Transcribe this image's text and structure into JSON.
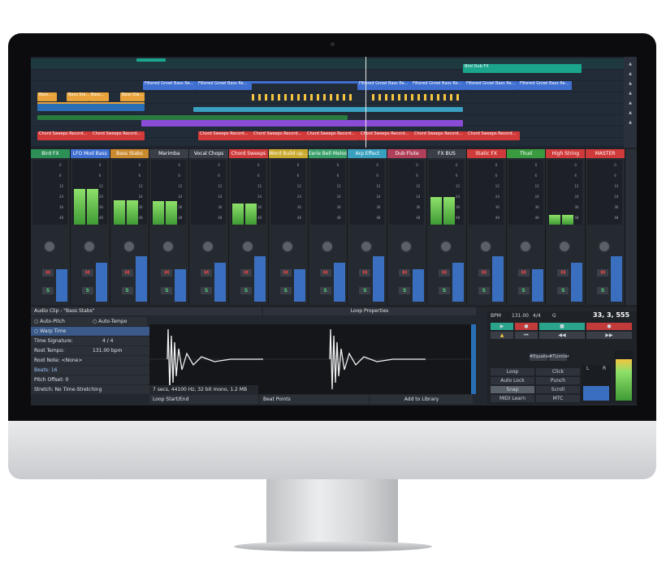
{
  "timeline": {
    "clips": [
      {
        "label": "Bird Dub FX",
        "color": "#1aa58c"
      },
      {
        "label": "Filtered Growl Bass Re...",
        "color": "#3f6fd1"
      },
      {
        "label": "Filtered Growl Bass Re...",
        "color": "#3f6fd1"
      },
      {
        "label": "Filtered Growl Bass Re...",
        "color": "#3f6fd1"
      },
      {
        "label": "Filtered Growl Bass Re...",
        "color": "#3f6fd1"
      },
      {
        "label": "Filtered Growl Bass Re...",
        "color": "#3f6fd1"
      },
      {
        "label": "Filtered Growl Bass Re...",
        "color": "#3f6fd1"
      },
      {
        "label": "Bass ...",
        "color": "#e8a43a"
      },
      {
        "label": "Bass Sta...",
        "color": "#e8a43a"
      },
      {
        "label": "Bass...",
        "color": "#e8a43a"
      },
      {
        "label": "Bass Sta...",
        "color": "#e8a43a"
      },
      {
        "label": "Chord Sweeps Record...",
        "color": "#d23a3a"
      },
      {
        "label": "Chord Sweeps Record...",
        "color": "#d23a3a"
      },
      {
        "label": "Chord Sweeps Record...",
        "color": "#d23a3a"
      },
      {
        "label": "Chord Sweeps Record...",
        "color": "#d23a3a"
      },
      {
        "label": "Chord Sweeps Record...",
        "color": "#d23a3a"
      },
      {
        "label": "Chord Sweeps Record...",
        "color": "#d23a3a"
      },
      {
        "label": "Chord Sweeps Record...",
        "color": "#d23a3a"
      },
      {
        "label": "Chord Sweeps Record...",
        "color": "#d23a3a"
      }
    ]
  },
  "mixer": {
    "channels": [
      {
        "name": "Bird FX",
        "color": "#2c8f56",
        "level": 0
      },
      {
        "name": "LFO Mod Bass",
        "color": "#3f6fd1",
        "level": 0.55
      },
      {
        "name": "Bass Stabs",
        "color": "#c98a30",
        "level": 0.38
      },
      {
        "name": "Marimba",
        "color": "#3a3f47",
        "level": 0.36
      },
      {
        "name": "Vocal Chops",
        "color": "#3a3f47",
        "level": 0
      },
      {
        "name": "Chord Sweeps",
        "color": "#cf3a3a",
        "level": 0.33
      },
      {
        "name": "Word Build up...",
        "color": "#c9a92e",
        "level": 0
      },
      {
        "name": "Eerie Bell Melody",
        "color": "#3aa06a",
        "level": 0
      },
      {
        "name": "Arp Effect",
        "color": "#3aa0c0",
        "level": 0
      },
      {
        "name": "Dub Flute",
        "color": "#b0405a",
        "level": 0
      },
      {
        "name": "FX BUS",
        "color": "#3a3f47",
        "level": 0.42
      },
      {
        "name": "Static FX",
        "color": "#cf3a3a",
        "level": 0
      },
      {
        "name": "Thud",
        "color": "#3a9a40",
        "level": 0
      },
      {
        "name": "High String",
        "color": "#cf3a3a",
        "level": 0.15
      },
      {
        "name": "MASTER",
        "color": "#cf3a3a",
        "level": 0
      }
    ],
    "tick_labels": [
      "0",
      "6",
      "12",
      "24",
      "36",
      "48"
    ],
    "mute": "M",
    "solo": "S"
  },
  "clip_panel": {
    "title": "Audio Clip - \"Bass Stabs\"",
    "loop_properties": "Loop Properties",
    "auto_pitch": "Auto-Pitch",
    "auto_tempo": "Auto-Tempo",
    "warp_time": "Warp Time",
    "time_signature_label": "Time Signature:",
    "time_signature_value": "4  /  4",
    "root_tempo_label": "Root Tempo:",
    "root_tempo_value": "131.00 bpm",
    "root_note": "Root Note: <None>",
    "beats": "Beats: 16",
    "pitch_offset": "Pitch Offset: 0",
    "stretch": "Stretch: No Time-Stretching",
    "wave_info": "7 secs, 44100 Hz, 32 bit mono, 1.2 MB",
    "loop_start_end": "Loop Start/End",
    "beat_points": "Beat Points",
    "add_to_library": "Add to Library"
  },
  "transport": {
    "bpm_label": "BPM",
    "bpm": "131.00",
    "time_sig": "4/4",
    "key": "G",
    "position": "33, 3, 555",
    "plugin1": "#Equaliser",
    "plugin2": "#TLimiter",
    "loop": "Loop",
    "click": "Click",
    "auto_lock": "Auto Lock",
    "punch": "Punch",
    "snap": "Snap",
    "scroll": "Scroll",
    "midi_learn": "MIDI Learn",
    "mtc": "MTC",
    "meter_l": "L",
    "meter_r": "R",
    "master_meter_level": 0.82
  }
}
